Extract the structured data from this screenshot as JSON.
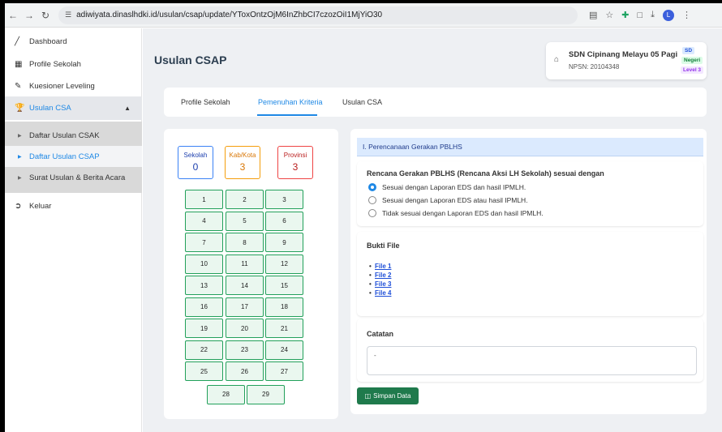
{
  "browser": {
    "url": "adiwiyata.dinaslhdki.id/usulan/csap/update/YToxOntzOjM6InZhbCI7czozOiI1MjYiO30",
    "avatar_letter": "L"
  },
  "sidebar": {
    "items": [
      {
        "label": "Dashboard"
      },
      {
        "label": "Profile Sekolah"
      },
      {
        "label": "Kuesioner Leveling"
      },
      {
        "label": "Usulan CSA"
      },
      {
        "label": "Keluar"
      }
    ],
    "submenu": [
      {
        "label": "Daftar Usulan CSAK"
      },
      {
        "label": "Daftar Usulan CSAP"
      },
      {
        "label": "Surat Usulan & Berita Acara"
      }
    ]
  },
  "header": {
    "title": "Usulan CSAP",
    "school_name": "SDN Cipinang Melayu 05 Pagi",
    "npsn": "NPSN: 20104348",
    "badges": {
      "jenjang": "SD",
      "status": "Negeri",
      "level": "Level 3"
    }
  },
  "tabs": [
    {
      "label": "Profile Sekolah"
    },
    {
      "label": "Pemenuhan Kriteria"
    },
    {
      "label": "Usulan CSA"
    }
  ],
  "stats": {
    "sekolah_label": "Sekolah",
    "sekolah_value": "0",
    "kabkota_label": "Kab/Kota",
    "kabkota_value": "3",
    "provinsi_label": "Provinsi",
    "provinsi_value": "3"
  },
  "criteria_numbers": [
    "1",
    "2",
    "3",
    "4",
    "5",
    "6",
    "7",
    "8",
    "9",
    "10",
    "11",
    "12",
    "13",
    "14",
    "15",
    "16",
    "17",
    "18",
    "19",
    "20",
    "21",
    "22",
    "23",
    "24",
    "25",
    "26",
    "27",
    "28",
    "29"
  ],
  "form": {
    "section_title": "I. Perencanaan Gerakan PBLHS",
    "question": "Rencana Gerakan PBLHS (Rencana Aksi LH Sekolah) sesuai dengan",
    "options": [
      {
        "label": "Sesuai dengan Laporan EDS dan hasil IPMLH.",
        "selected": true
      },
      {
        "label": "Sesuai dengan Laporan EDS atau hasil IPMLH.",
        "selected": false
      },
      {
        "label": "Tidak sesuai dengan Laporan EDS dan hasil IPMLH.",
        "selected": false
      }
    ],
    "bukti_title": "Bukti File",
    "files": [
      "File 1",
      "File 2",
      "File 3",
      "File 4"
    ],
    "catatan_title": "Catatan",
    "catatan_value": "-",
    "save_label": "Simpan Data"
  }
}
